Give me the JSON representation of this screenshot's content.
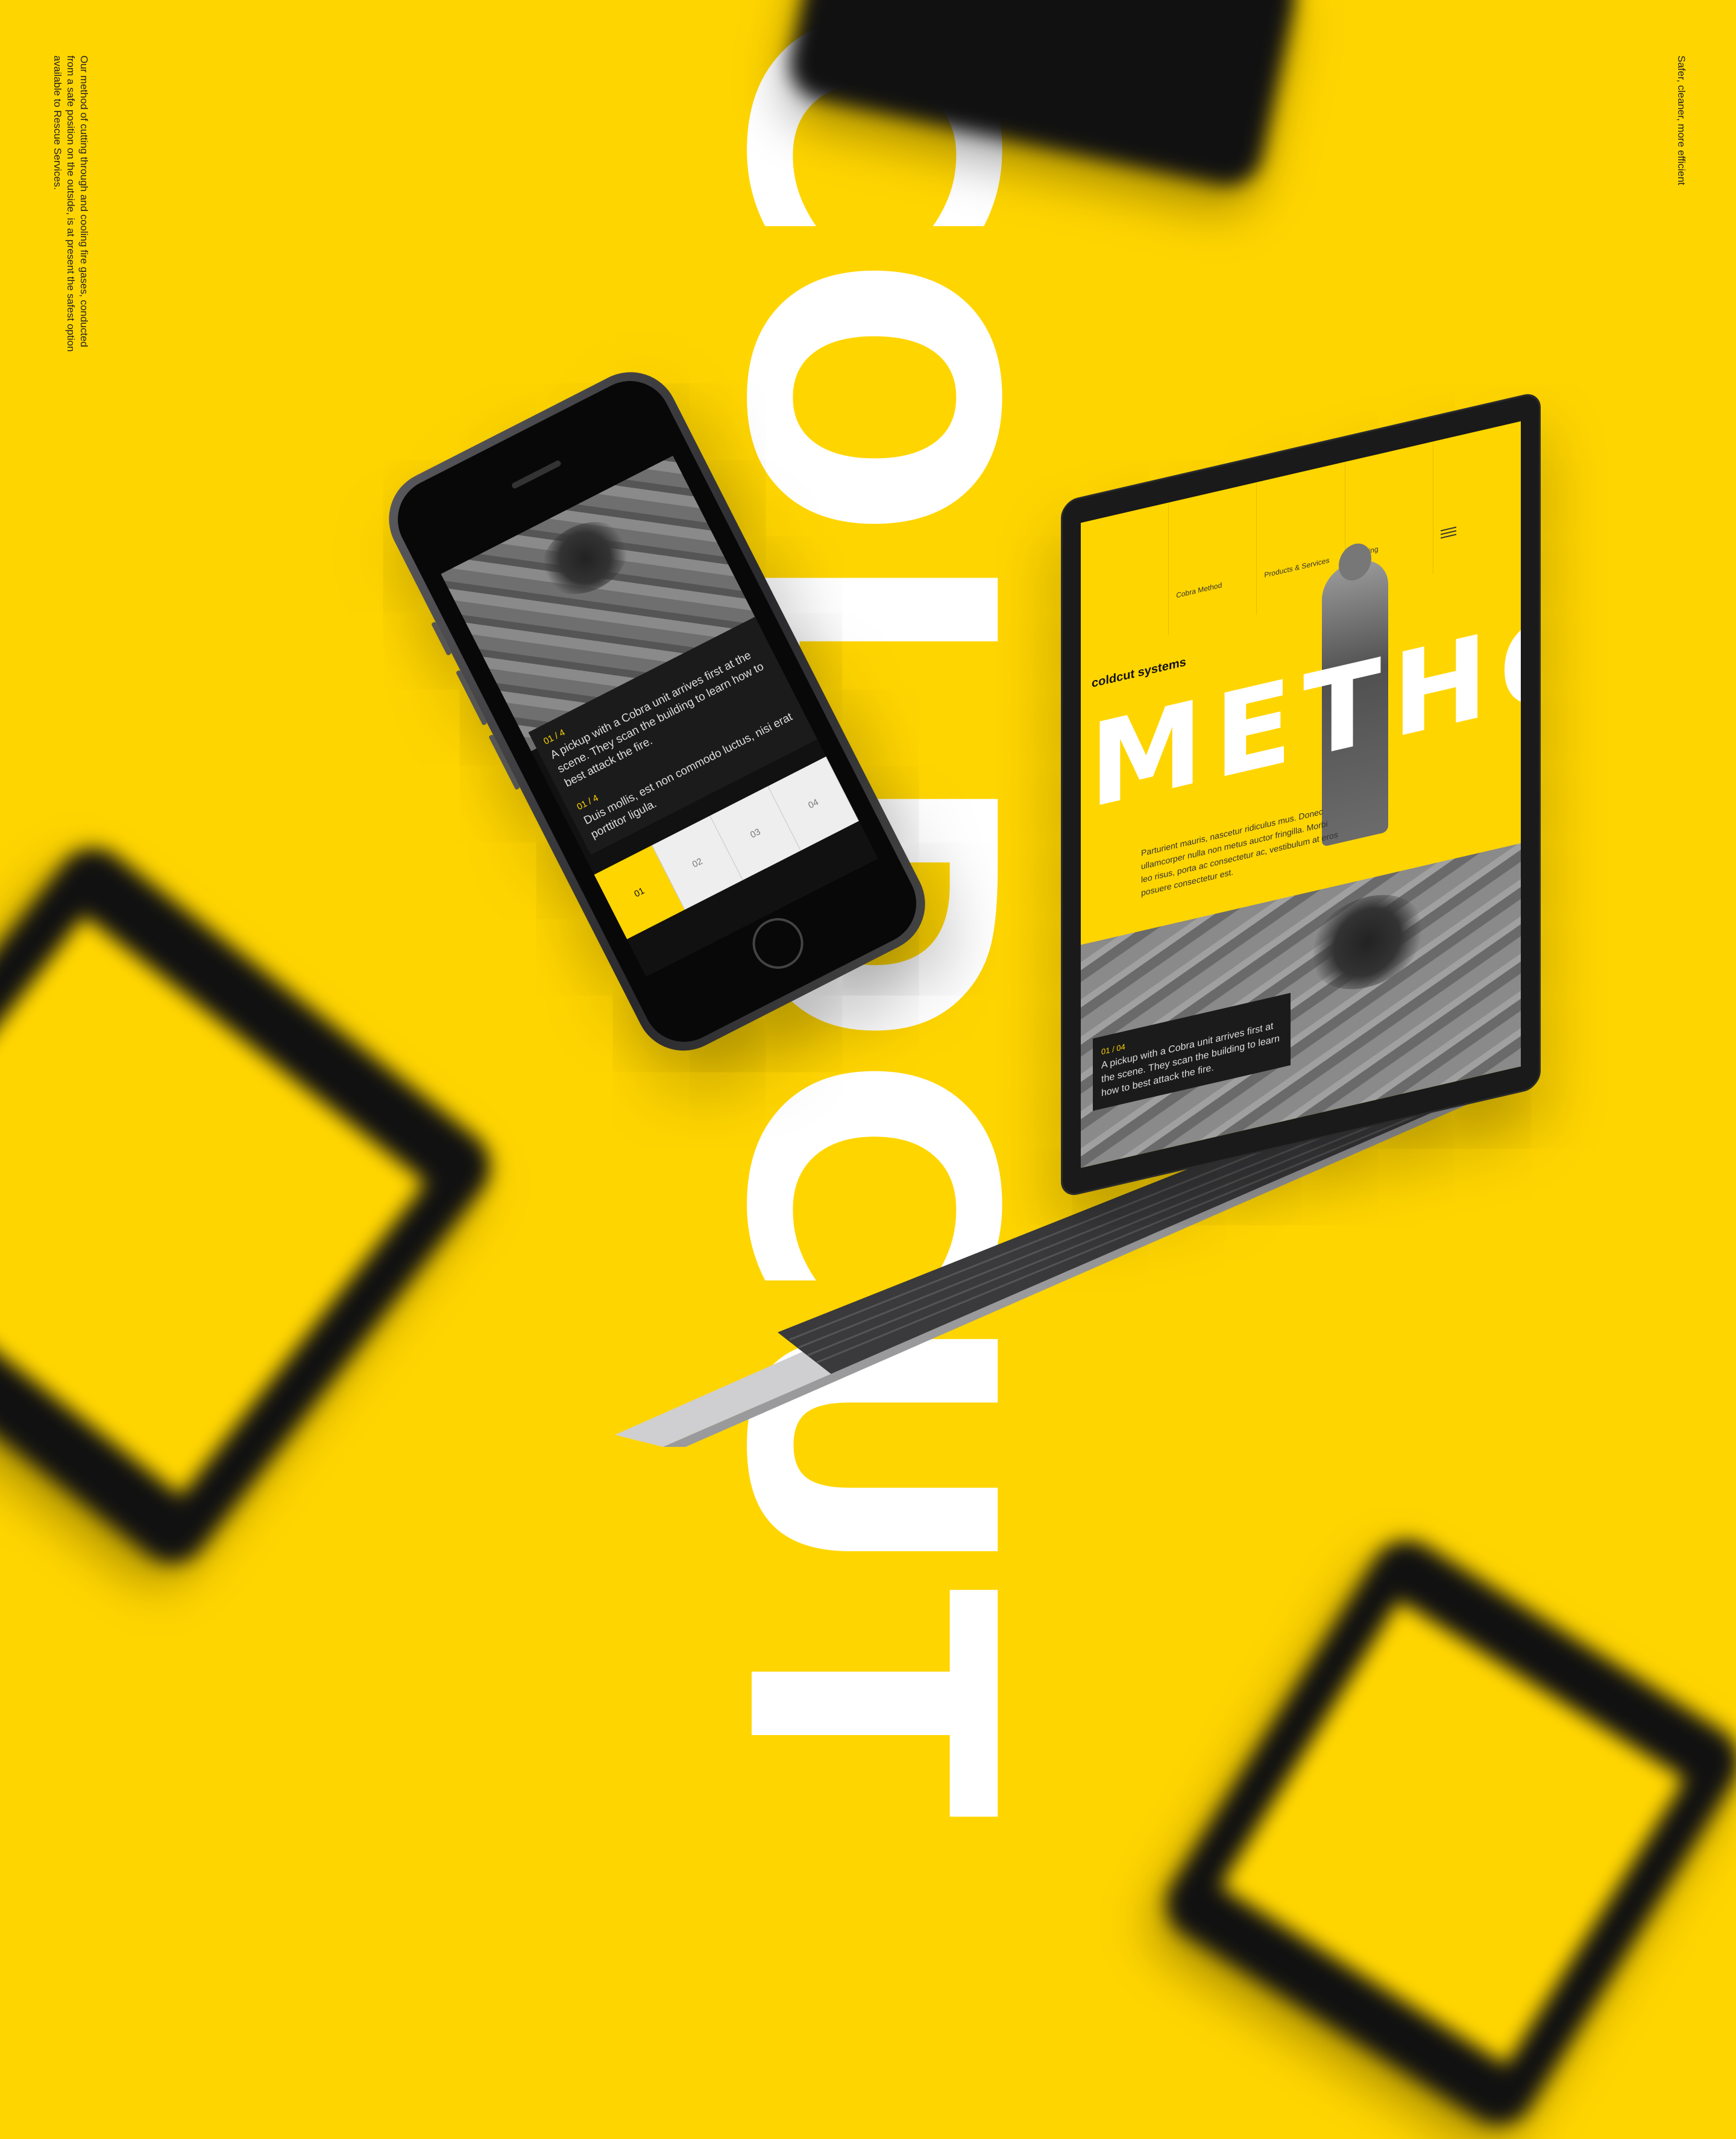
{
  "captions": {
    "left": "Our method of cutting through and cooling fire gases, conducted from a safe position on the outside, is at present the safest option available to Rescue Services.",
    "right": "Safer, cleaner, more efficient"
  },
  "hero_word": "COLDCUT",
  "phone": {
    "card1_number": "01 / 4",
    "card1_text": "A pickup with a Cobra unit arrives first at the scene. They scan the building to learn how to best attack the fire.",
    "card2_number": "01 / 4",
    "card2_text": "Duis mollis, est non commodo luctus, nisi erat porttitor ligula.",
    "tabs": [
      "01",
      "02",
      "03",
      "04"
    ]
  },
  "laptop": {
    "nav_items": [
      "Cobra Method",
      "Products & Services",
      "Training",
      ""
    ],
    "logo": "coldcut systems",
    "title": "METHOD",
    "body": "Parturient mauris, nascetur ridiculus mus. Donec ullamcorper nulla non metus auctor fringilla. Morbi leo risus, porta ac consectetur ac, vestibulum at eros posuere consectetur est.",
    "card_number": "01 / 04",
    "card_text": "A pickup with a Cobra unit arrives first at the scene. They scan the building to learn how to best attack the fire."
  },
  "colors": {
    "background": "#FFD500",
    "hero_text": "#FFFFFF",
    "device": "#111111"
  }
}
